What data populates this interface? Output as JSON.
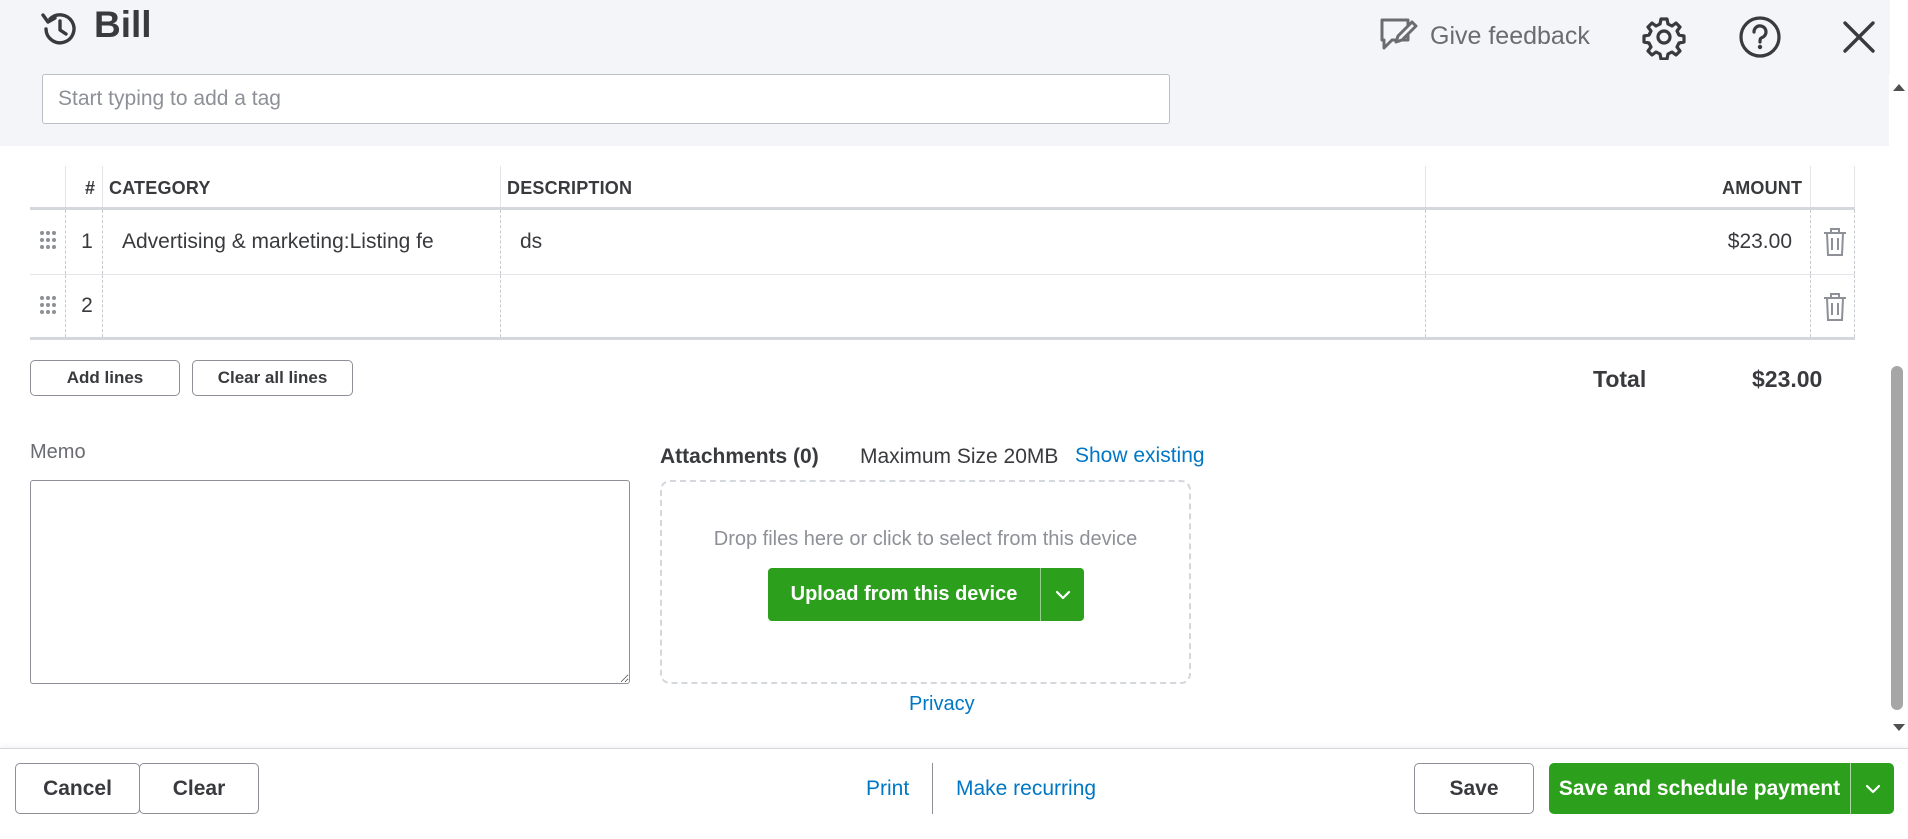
{
  "header": {
    "title": "Bill",
    "feedback_label": "Give feedback",
    "icons": [
      "history-icon",
      "feedback-icon",
      "gear-icon",
      "help-icon",
      "close-icon"
    ]
  },
  "tags": {
    "placeholder": "Start typing to add a tag"
  },
  "table": {
    "headers": {
      "num": "#",
      "category": "CATEGORY",
      "description": "DESCRIPTION",
      "amount": "AMOUNT"
    },
    "rows": [
      {
        "num": "1",
        "category": "Advertising & marketing:Listing fe",
        "description": "ds",
        "amount": "$23.00"
      },
      {
        "num": "2",
        "category": "",
        "description": "",
        "amount": ""
      }
    ]
  },
  "lines": {
    "add_label": "Add lines",
    "clear_label": "Clear all lines"
  },
  "total": {
    "label": "Total",
    "value": "$23.00"
  },
  "memo": {
    "label": "Memo"
  },
  "attachments": {
    "title": "Attachments (0)",
    "max_size": "Maximum Size 20MB",
    "show_existing": "Show existing",
    "drop_text": "Drop files here or click to select from this device",
    "upload_label": "Upload from this device",
    "privacy": "Privacy"
  },
  "footer": {
    "cancel": "Cancel",
    "clear": "Clear",
    "print": "Print",
    "make_recurring": "Make recurring",
    "save": "Save",
    "save_schedule": "Save and schedule payment"
  },
  "colors": {
    "accent_green": "#2ca01c",
    "link_blue": "#0077c5",
    "text": "#393a3d",
    "muted": "#8d9096",
    "band": "#f4f5f8"
  }
}
